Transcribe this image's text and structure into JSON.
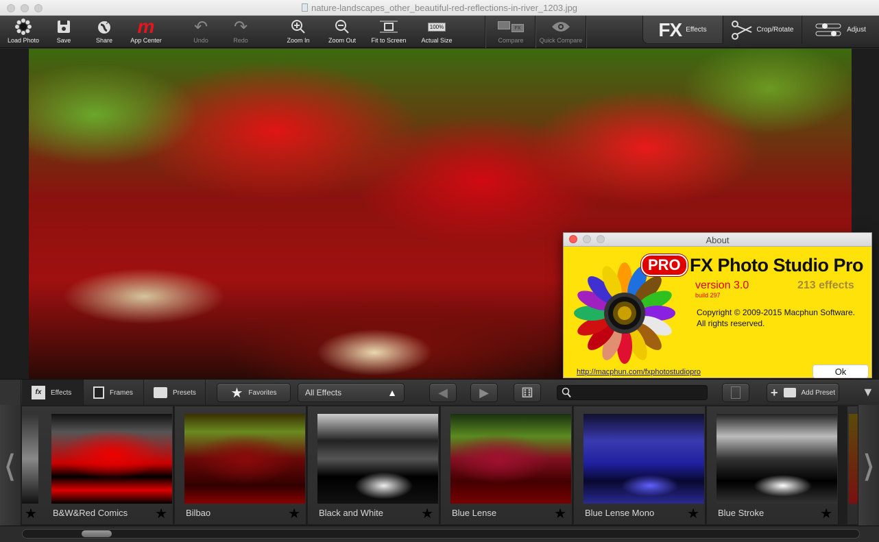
{
  "window": {
    "title": "nature-landscapes_other_beautiful-red-reflections-in-river_1203.jpg"
  },
  "toolbar": {
    "load_photo": "Load Photo",
    "save": "Save",
    "share": "Share",
    "app_center": "App Center",
    "undo": "Undo",
    "redo": "Redo",
    "zoom_in": "Zoom In",
    "zoom_out": "Zoom Out",
    "fit_to_screen": "Fit to Screen",
    "actual_size": "Actual Size",
    "actual_size_badge": "100%",
    "compare": "Compare",
    "quick_compare": "Quick Compare"
  },
  "mode_tabs": [
    {
      "label": "Effects",
      "glyph": "FX",
      "active": true
    },
    {
      "label": "Crop/Rotate",
      "active": false
    },
    {
      "label": "Adjust",
      "active": false
    }
  ],
  "about": {
    "title": "About",
    "badge": "PRO",
    "product": "FX Photo Studio Pro",
    "version": "version 3.0",
    "build": "build 297",
    "effects": "213 effects",
    "copyright": "Copyright © 2009-2015 Macphun Software.",
    "rights": "All rights reserved.",
    "link": "http://macphun.com/fxphotostudiopro",
    "ok": "Ok"
  },
  "effects_bar": {
    "tabs": [
      {
        "label": "Effects",
        "active": true
      },
      {
        "label": "Frames"
      },
      {
        "label": "Presets"
      }
    ],
    "favorites": "Favorites",
    "category": "All Effects",
    "search_placeholder": "",
    "add_preset": "Add Preset"
  },
  "effects": [
    {
      "name": "B&W&Red Comics"
    },
    {
      "name": "Bilbao"
    },
    {
      "name": "Black and White"
    },
    {
      "name": "Blue Lense"
    },
    {
      "name": "Blue Lense Mono"
    },
    {
      "name": "Blue Stroke"
    }
  ],
  "colors": {
    "about_bg": "#ffe20a",
    "version_red": "#e00000",
    "app_center_red": "#e8141c"
  }
}
